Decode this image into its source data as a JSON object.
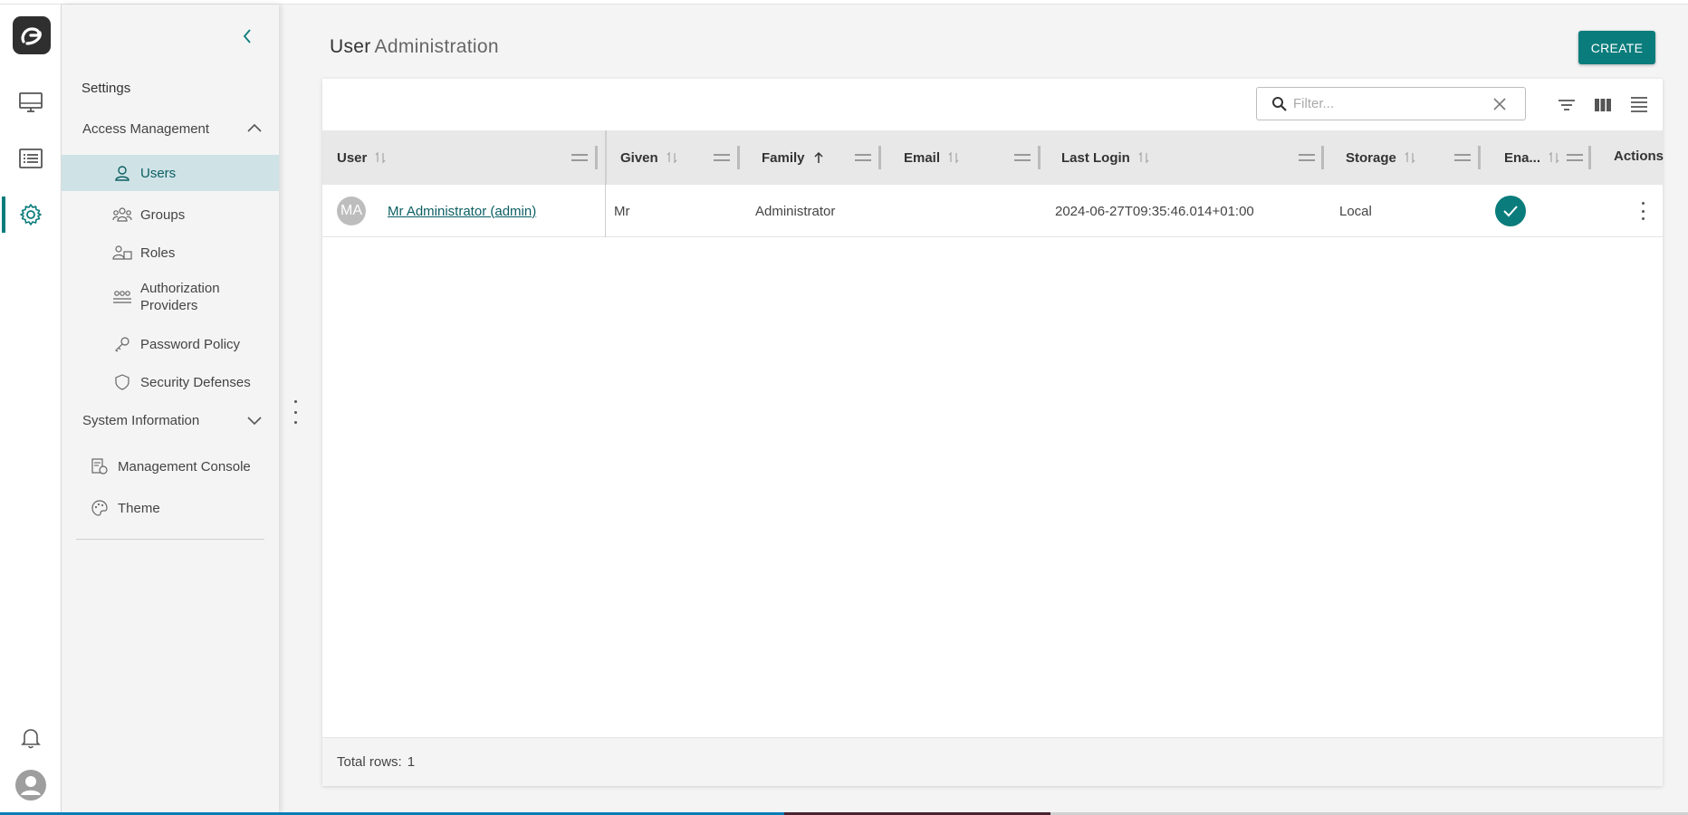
{
  "page": {
    "title_main": "User",
    "title_sub": "Administration",
    "create_label": "CREATE"
  },
  "rail": {
    "items": [
      "monitor-icon",
      "list-icon",
      "gear-icon"
    ],
    "bottom": [
      "bell-icon",
      "user-avatar-icon"
    ]
  },
  "sidebar": {
    "section_title": "Settings",
    "access_management": "Access Management",
    "items": [
      {
        "label": "Users",
        "icon": "user-icon"
      },
      {
        "label": "Groups",
        "icon": "groups-icon"
      },
      {
        "label": "Roles",
        "icon": "roles-icon"
      },
      {
        "label": "Authorization Providers",
        "icon": "providers-icon"
      },
      {
        "label": "Password Policy",
        "icon": "key-icon"
      },
      {
        "label": "Security Defenses",
        "icon": "shield-icon"
      }
    ],
    "system_information": "System Information",
    "system_items": [
      {
        "label": "Management Console",
        "icon": "console-icon"
      },
      {
        "label": "Theme",
        "icon": "palette-icon"
      }
    ]
  },
  "filter": {
    "placeholder": "Filter..."
  },
  "table": {
    "columns": [
      "User",
      "Given",
      "Family",
      "Email",
      "Last Login",
      "Storage",
      "Ena...",
      "Actions"
    ],
    "rows": [
      {
        "avatar": "MA",
        "user": "Mr Administrator (admin)",
        "given": "Mr",
        "family": "Administrator",
        "email": "",
        "last_login": "2024-06-27T09:35:46.014+01:00",
        "storage": "Local",
        "enabled": true
      }
    ]
  },
  "footer": {
    "label": "Total rows:",
    "count": "1"
  },
  "colors": {
    "accent": "#0b7c7c",
    "active_bg": "#cfe3e6"
  }
}
